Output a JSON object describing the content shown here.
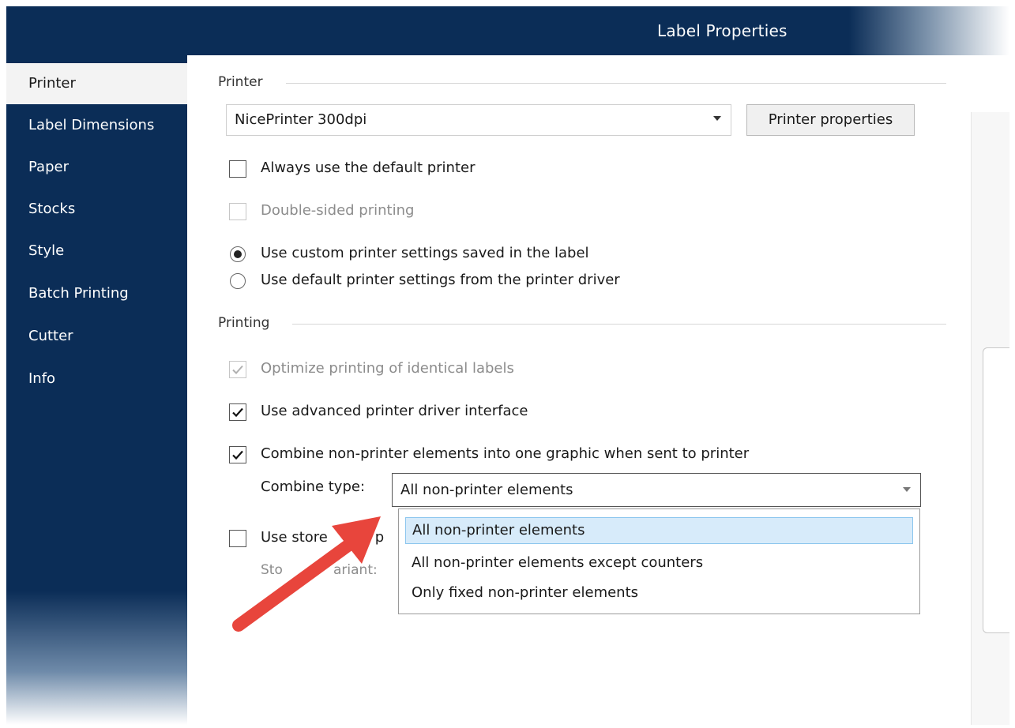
{
  "window": {
    "title": "Label Properties"
  },
  "sidebar": {
    "items": [
      {
        "label": "Printer",
        "active": true
      },
      {
        "label": "Label Dimensions"
      },
      {
        "label": "Paper"
      },
      {
        "label": "Stocks"
      },
      {
        "label": "Style"
      },
      {
        "label": "Batch Printing"
      },
      {
        "label": "Cutter"
      },
      {
        "label": "Info"
      }
    ]
  },
  "printer_section": {
    "header": "Printer",
    "printer_select": {
      "value": "NicePrinter 300dpi"
    },
    "printer_properties_button": "Printer properties",
    "always_default": {
      "label": "Always use the default printer",
      "checked": false
    },
    "double_sided": {
      "label": "Double-sided printing",
      "checked": false,
      "disabled": true
    },
    "radio_custom": {
      "label": "Use custom printer settings saved in the label",
      "selected": true
    },
    "radio_default": {
      "label": "Use default printer settings from the printer driver",
      "selected": false
    }
  },
  "printing_section": {
    "header": "Printing",
    "optimize": {
      "label": "Optimize printing of identical labels",
      "checked": true,
      "disabled": true
    },
    "advanced_interface": {
      "label": "Use advanced printer driver interface",
      "checked": true
    },
    "combine": {
      "label": "Combine non-printer elements into one graphic when sent to printer",
      "checked": true
    },
    "combine_type_label": "Combine type:",
    "combine_type_value": "All non-printer elements",
    "combine_options": [
      "All non-printer elements",
      "All non-printer elements except counters",
      "Only fixed non-printer elements"
    ],
    "use_stored_fragment": "Use store",
    "use_stored_suffix": "all p",
    "store_variant_fragment_a": "Sto",
    "store_variant_fragment_b": "ariant:"
  },
  "colors": {
    "sidebar_bg": "#0b2d57",
    "selected_option_bg": "#d7ebfa",
    "annotation_arrow": "#e8453c"
  }
}
